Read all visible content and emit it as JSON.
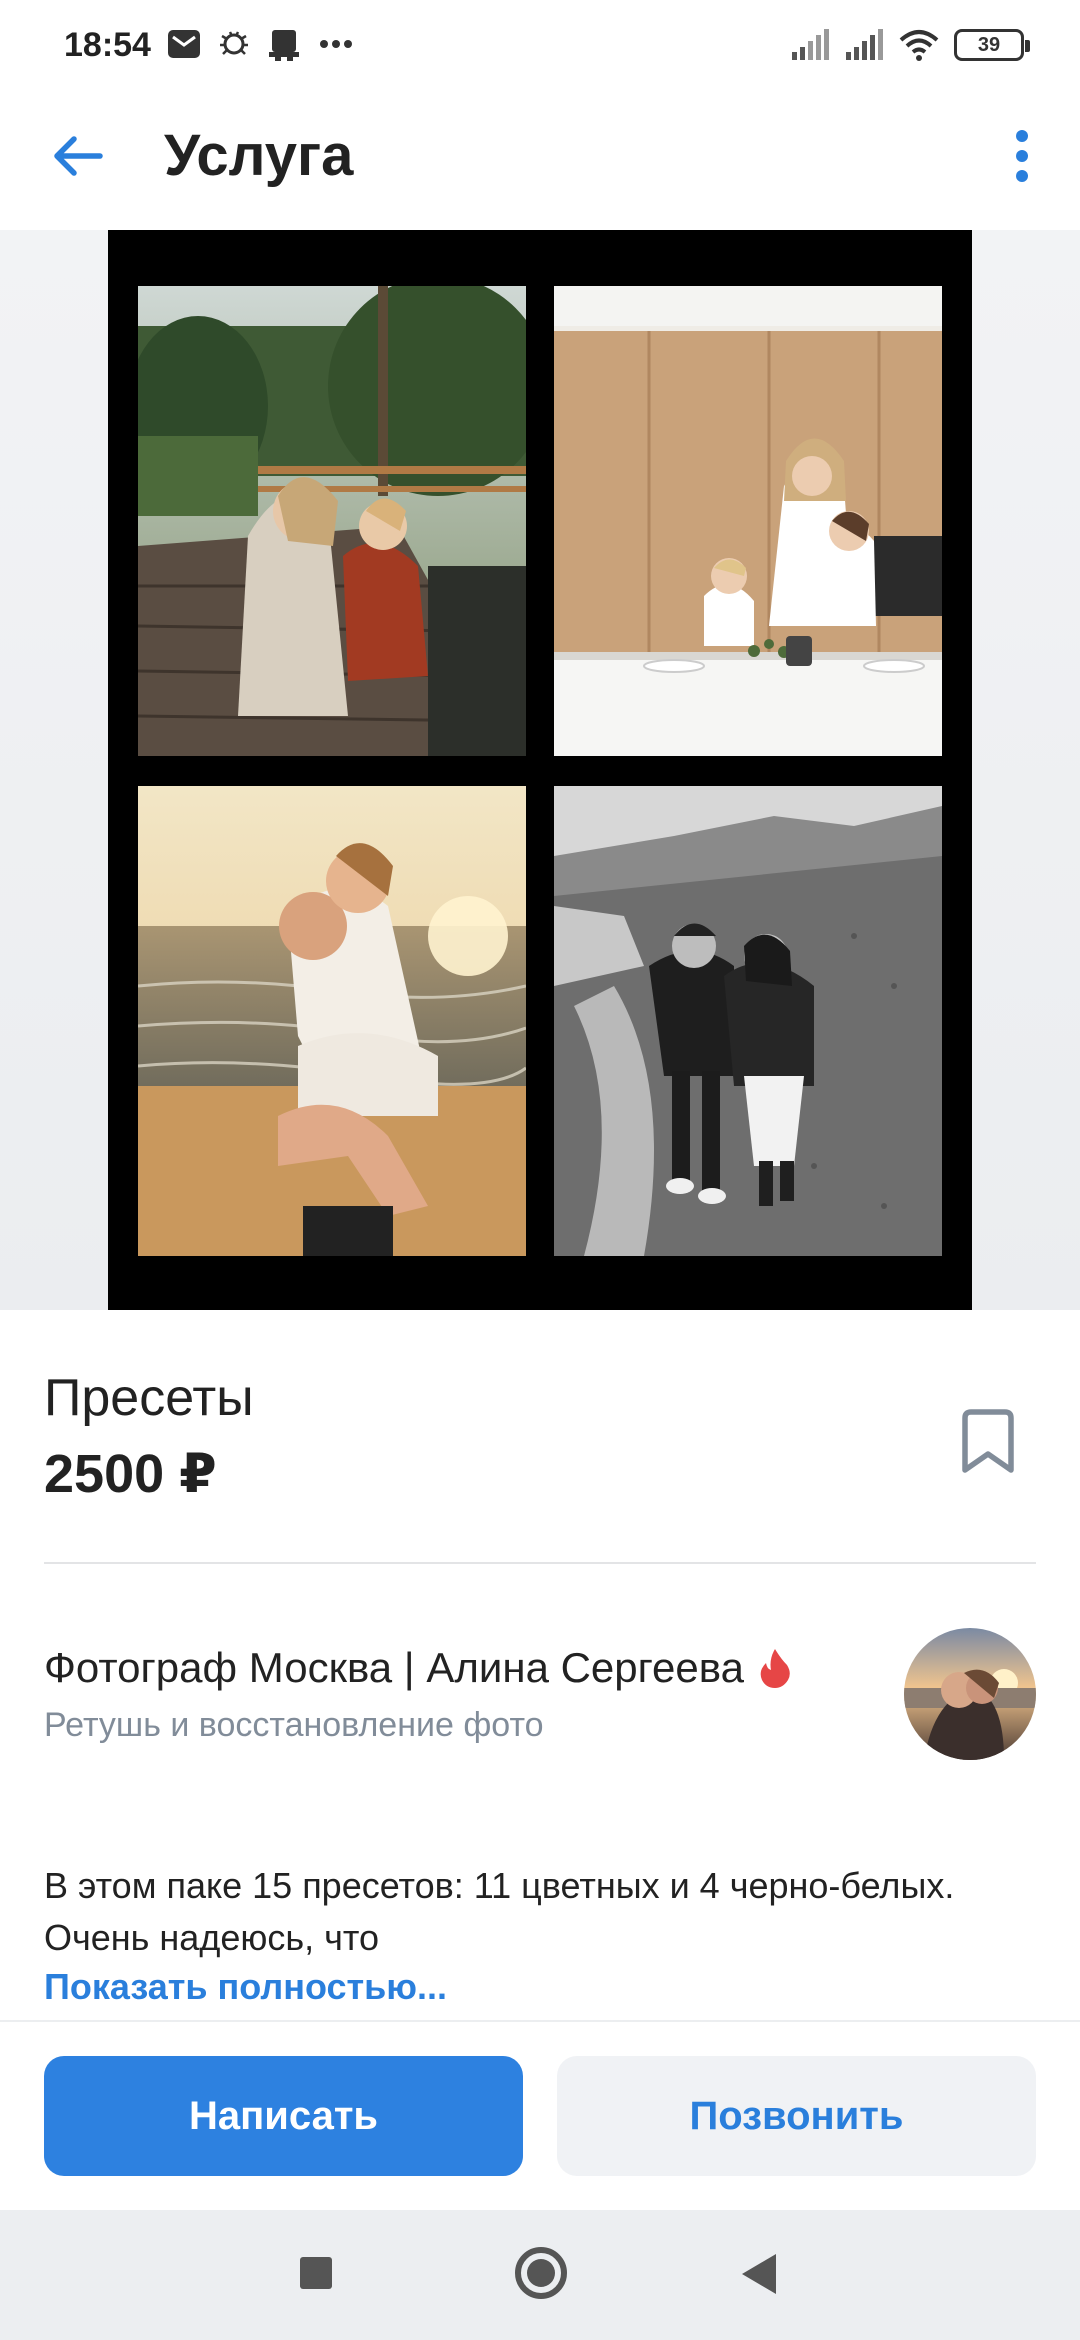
{
  "status_bar": {
    "time": "18:54",
    "battery": "39",
    "icons": [
      "mail-icon",
      "bug-icon",
      "printer-icon",
      "more-notifications-icon",
      "signal-icon",
      "signal-icon",
      "wifi-icon",
      "battery-icon"
    ]
  },
  "header": {
    "title": "Услуга",
    "back_icon": "arrow-left-icon",
    "more_icon": "vertical-dots-icon",
    "accent": "#2a7fdc"
  },
  "gallery": {
    "photos": [
      "family-on-wooden-pier",
      "mother-and-children-in-kitchen",
      "couple-kissing-on-beach",
      "black-and-white-couple-walking"
    ]
  },
  "product": {
    "title": "Пресеты",
    "price": "2500 ₽",
    "bookmark_icon": "bookmark-icon"
  },
  "seller": {
    "name": "Фотограф Москва | Алина Сергеева",
    "subtitle": "Ретушь и восстановление фото",
    "badge_icon": "flame-icon",
    "badge_color": "#e64646"
  },
  "description": {
    "text": "В этом паке 15 пресетов: 11 цветных и 4 черно-белых. Очень надеюсь, что",
    "show_more": "Показать полностью..."
  },
  "actions": {
    "write": "Написать",
    "call": "Позвонить",
    "primary_color": "#2d81e0"
  },
  "nav": {
    "icons": [
      "square-recent-icon",
      "circle-home-icon",
      "triangle-back-icon"
    ]
  }
}
